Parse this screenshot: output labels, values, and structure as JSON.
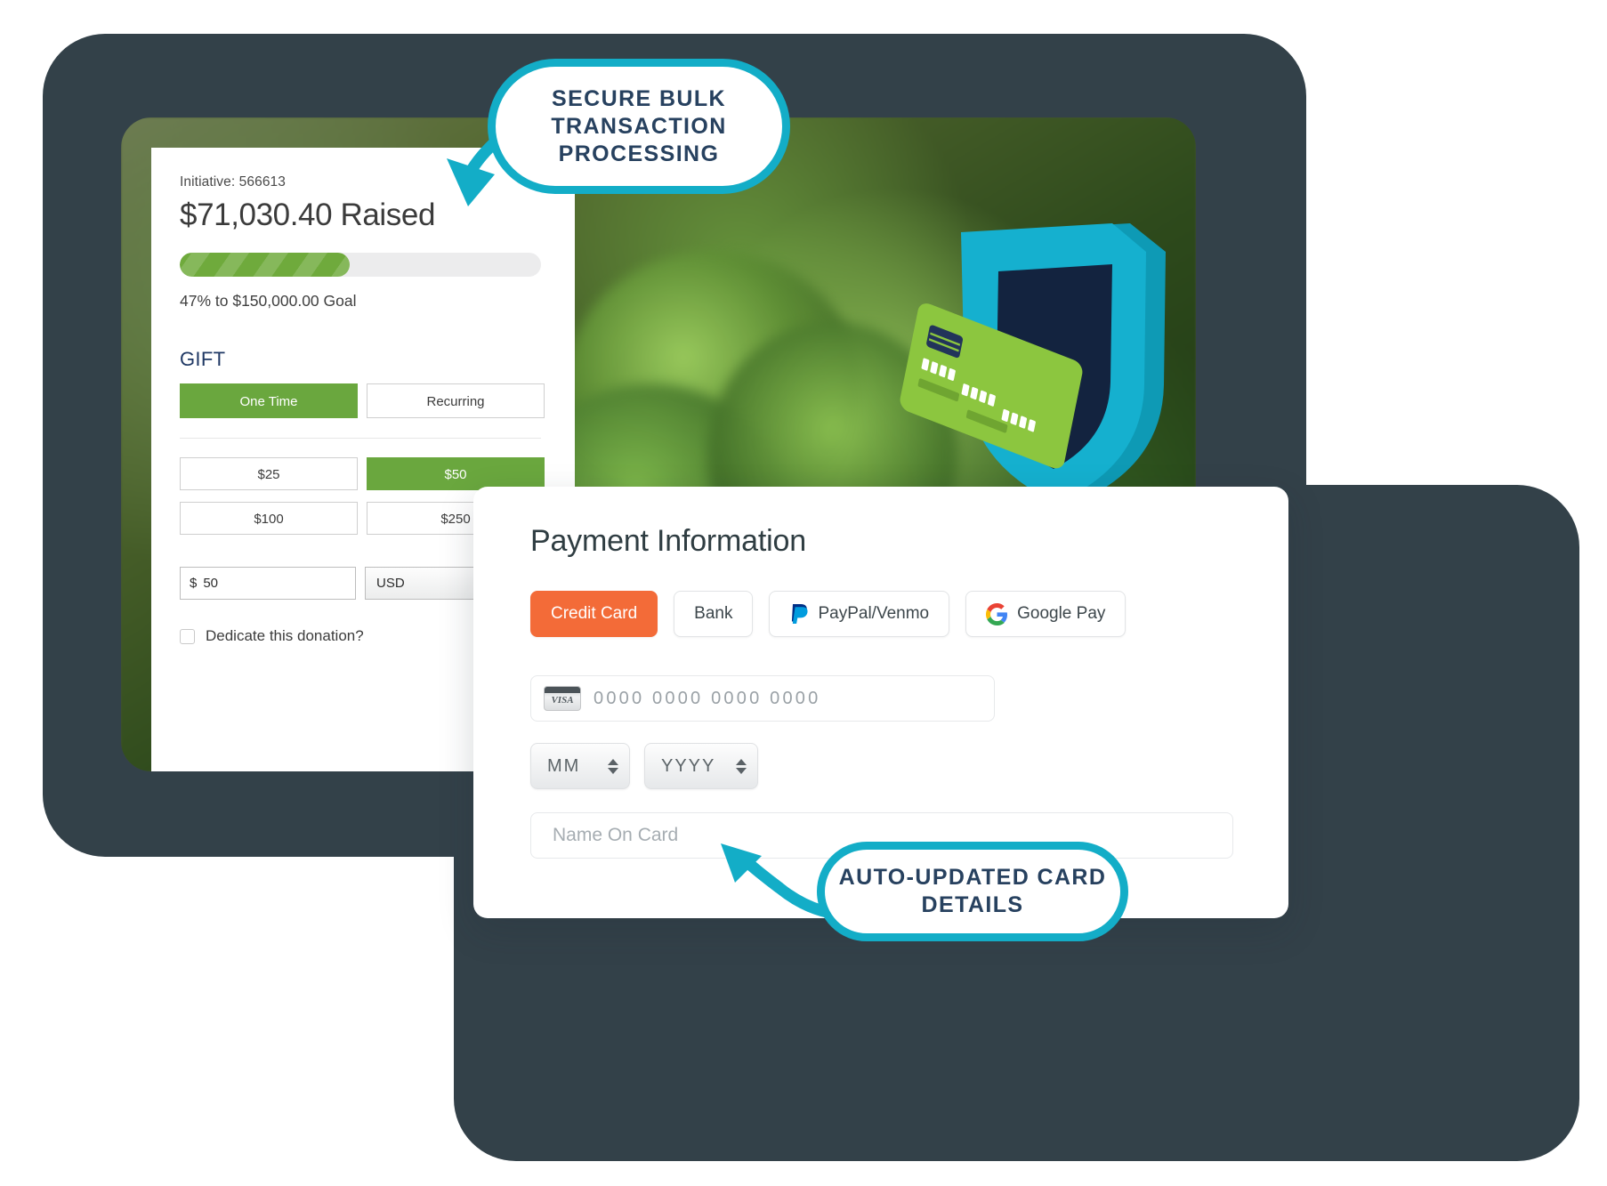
{
  "callouts": {
    "top": "SECURE BULK TRANSACTION PROCESSING",
    "bottom": "AUTO-UPDATED CARD DETAILS"
  },
  "donation_form": {
    "initiative": "Initiative: 566613",
    "raised": "$71,030.40 Raised",
    "progress_percent": 47,
    "goal_text": "47% to $150,000.00 Goal",
    "gift_label": "GIFT",
    "frequency_options": [
      {
        "label": "One Time",
        "selected": true
      },
      {
        "label": "Recurring",
        "selected": false
      }
    ],
    "amount_options": [
      {
        "label": "$25",
        "selected": false
      },
      {
        "label": "$50",
        "selected": true
      },
      {
        "label": "$100",
        "selected": false
      },
      {
        "label": "$250",
        "selected": false
      }
    ],
    "custom_amount": {
      "prefix": "$",
      "value": "50"
    },
    "currency": "USD",
    "dedicate_label": "Dedicate this donation?",
    "dedicate_checked": false
  },
  "payment": {
    "title": "Payment Information",
    "methods": [
      {
        "label": "Credit Card",
        "icon": "none",
        "active": true
      },
      {
        "label": "Bank",
        "icon": "none",
        "active": false
      },
      {
        "label": "PayPal/Venmo",
        "icon": "paypal-icon",
        "active": false
      },
      {
        "label": "Google Pay",
        "icon": "google-icon",
        "active": false
      }
    ],
    "card_number_placeholder": "0000 0000 0000 0000",
    "card_brand_icon": "visa-icon",
    "visa_text": "VISA",
    "expiry_month_placeholder": "MM",
    "expiry_year_placeholder": "YYYY",
    "name_on_card_placeholder": "Name On Card"
  },
  "colors": {
    "accent_cyan": "#13ADC7",
    "navy_text": "#27415f",
    "green": "#6aa73e",
    "orange": "#f36b38",
    "slate_frame": "#334149",
    "shield_cyan": "#15b0cf",
    "shield_navy": "#13233f",
    "card_green": "#8cc63f"
  }
}
